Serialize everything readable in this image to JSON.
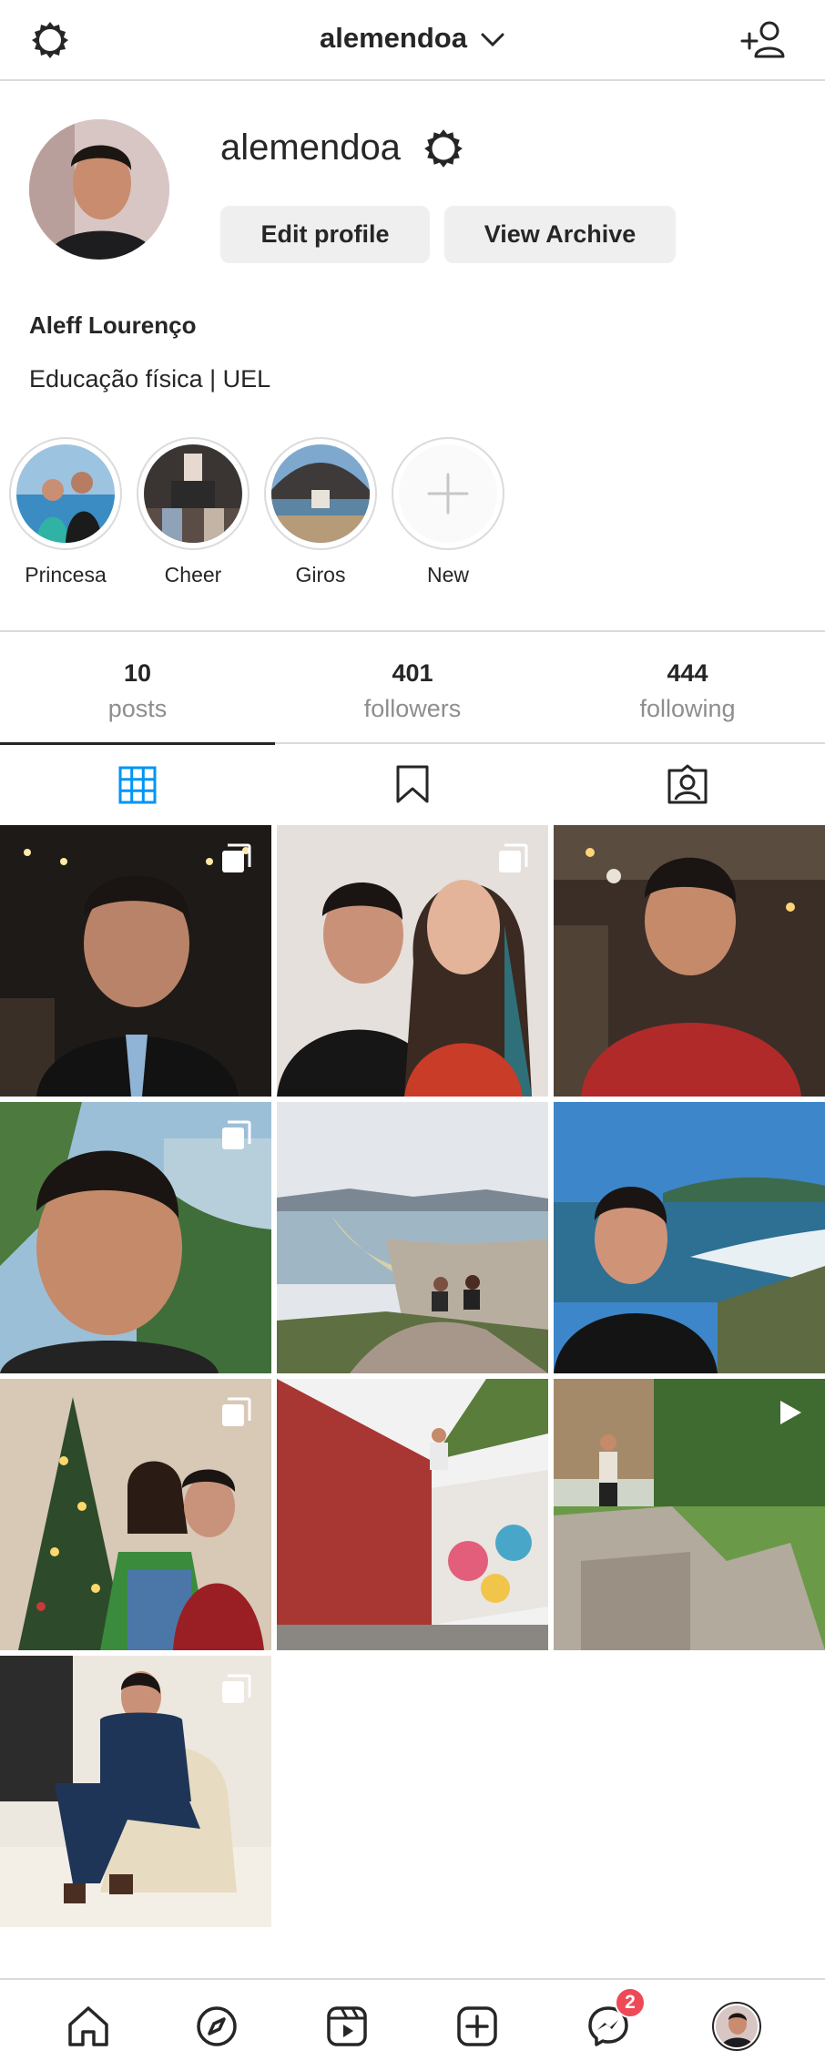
{
  "header": {
    "username": "alemendoa",
    "settings_icon": "gear-icon",
    "switch_account_icon": "chevron-down-icon",
    "discover_people_icon": "add-user-icon"
  },
  "profile": {
    "username": "alemendoa",
    "edit_button": "Edit profile",
    "archive_button": "View Archive",
    "full_name": "Aleff Lourenço",
    "bio": "Educação física | UEL"
  },
  "highlights": [
    {
      "label": "Princesa"
    },
    {
      "label": "Cheer"
    },
    {
      "label": "Giros"
    },
    {
      "label": "New"
    }
  ],
  "stats": [
    {
      "value": "10",
      "label": "posts"
    },
    {
      "value": "401",
      "label": "followers"
    },
    {
      "value": "444",
      "label": "following"
    }
  ],
  "tabs": [
    {
      "icon": "grid-icon",
      "active": true
    },
    {
      "icon": "bookmark-icon",
      "active": false
    },
    {
      "icon": "tagged-icon",
      "active": false
    }
  ],
  "posts": [
    {
      "badge": "carousel-icon"
    },
    {
      "badge": "carousel-icon"
    },
    {
      "badge": ""
    },
    {
      "badge": "carousel-icon"
    },
    {
      "badge": ""
    },
    {
      "badge": ""
    },
    {
      "badge": "carousel-icon"
    },
    {
      "badge": ""
    },
    {
      "badge": "video-icon"
    },
    {
      "badge": "carousel-icon"
    }
  ],
  "bottom_nav": {
    "items": [
      "home-icon",
      "explore-icon",
      "reels-icon",
      "new-post-icon",
      "messenger-icon",
      "profile-avatar"
    ],
    "messages_badge": "2"
  },
  "colors": {
    "accent": "#0095f6",
    "notification": "#ed4956",
    "muted_text": "#8e8e8e",
    "border": "#dbdbdb",
    "button_bg": "#efefef"
  }
}
